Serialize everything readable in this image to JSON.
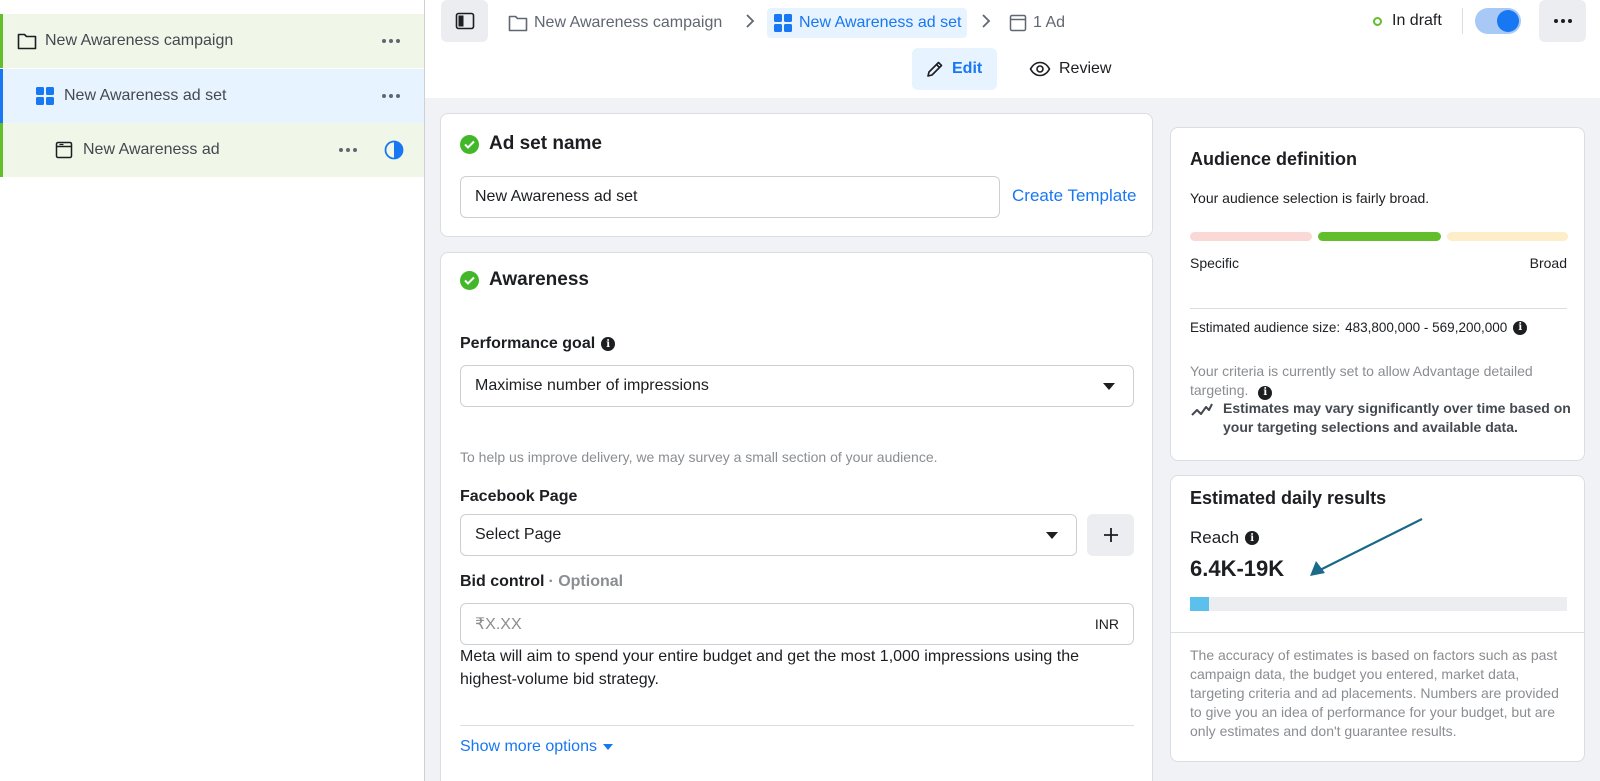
{
  "sidebar": {
    "items": [
      {
        "label": "New Awareness campaign"
      },
      {
        "label": "New Awareness ad set"
      },
      {
        "label": "New Awareness ad"
      }
    ]
  },
  "header": {
    "breadcrumb": {
      "campaign": "New Awareness campaign",
      "adset": "New Awareness ad set",
      "ad": "1 Ad"
    },
    "status": "In draft",
    "tabs": {
      "edit": "Edit",
      "review": "Review"
    }
  },
  "adset_name": {
    "title": "Ad set name",
    "value": "New Awareness ad set",
    "create_template": "Create Template"
  },
  "awareness": {
    "title": "Awareness",
    "performance_goal_label": "Performance goal",
    "performance_goal_value": "Maximise number of impressions",
    "survey_note": "To help us improve delivery, we may survey a small section of your audience.",
    "facebook_page_label": "Facebook Page",
    "facebook_page_value": "Select Page",
    "bid_control_label": "Bid control",
    "bid_control_optional": "· Optional",
    "bid_placeholder": "₹X.XX",
    "bid_currency": "INR",
    "bid_description": "Meta will aim to spend your entire budget and get the most 1,000 impressions using the highest-volume bid strategy.",
    "show_more": "Show more options"
  },
  "audience": {
    "title": "Audience definition",
    "summary": "Your audience selection is fairly broad.",
    "specific_label": "Specific",
    "broad_label": "Broad",
    "size_label": "Estimated audience size:",
    "size_value": "483,800,000 - 569,200,000",
    "criteria_note": "Your criteria is currently set to allow Advantage detailed targeting.",
    "vary_note": "Estimates may vary significantly over time based on your targeting selections and available data.",
    "meter_colors": {
      "specific": "#f9d8d6",
      "current": "#63be2c",
      "broad": "#fdeec9"
    }
  },
  "estimates": {
    "title": "Estimated daily results",
    "reach_label": "Reach",
    "reach_value": "6.4K-19K",
    "reach_bar_fraction": 0.05,
    "footnote": "The accuracy of estimates is based on factors such as past campaign data, the budget you entered, market data, targeting criteria and ad placements. Numbers are provided to give you an idea of performance for your budget, but are only estimates and don't guarantee results."
  },
  "colors": {
    "accent": "#1877f2",
    "success": "#42b72a",
    "annotation_arrow": "#1b6a8a"
  }
}
